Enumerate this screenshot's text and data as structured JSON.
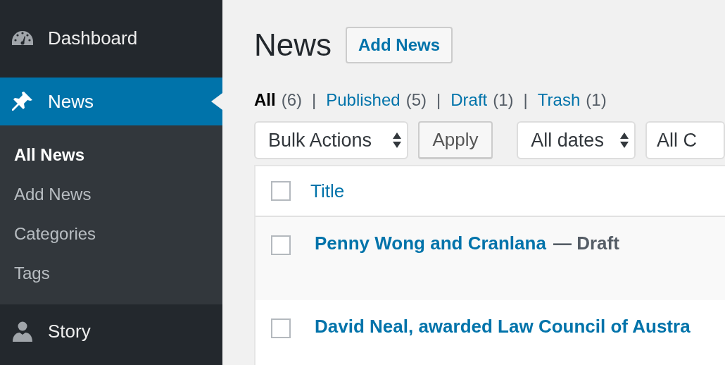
{
  "sidebar": {
    "items": [
      {
        "label": "Dashboard",
        "selected": false
      },
      {
        "label": "News",
        "selected": true,
        "children": [
          {
            "label": "All News",
            "selected": true
          },
          {
            "label": "Add News",
            "selected": false
          },
          {
            "label": "Categories",
            "selected": false
          },
          {
            "label": "Tags",
            "selected": false
          }
        ]
      },
      {
        "label": "Story",
        "selected": false
      }
    ]
  },
  "page": {
    "title": "News",
    "add_button": "Add News"
  },
  "filters": [
    {
      "label": "All",
      "count": "(6)",
      "selected": true
    },
    {
      "label": "Published",
      "count": "(5)",
      "selected": false
    },
    {
      "label": "Draft",
      "count": "(1)",
      "selected": false
    },
    {
      "label": "Trash",
      "count": "(1)",
      "selected": false
    }
  ],
  "separator": "|",
  "toolbar": {
    "bulk_actions": "Bulk Actions",
    "apply": "Apply",
    "dates": "All dates",
    "categories": "All C"
  },
  "table": {
    "columns": [
      {
        "label": "Title",
        "checked": false
      }
    ],
    "rows": [
      {
        "title": "Penny Wong and Cranlana",
        "state": "— Draft",
        "checked": false
      },
      {
        "title": "David Neal, awarded Law Council of Austra",
        "checked": false
      }
    ]
  }
}
